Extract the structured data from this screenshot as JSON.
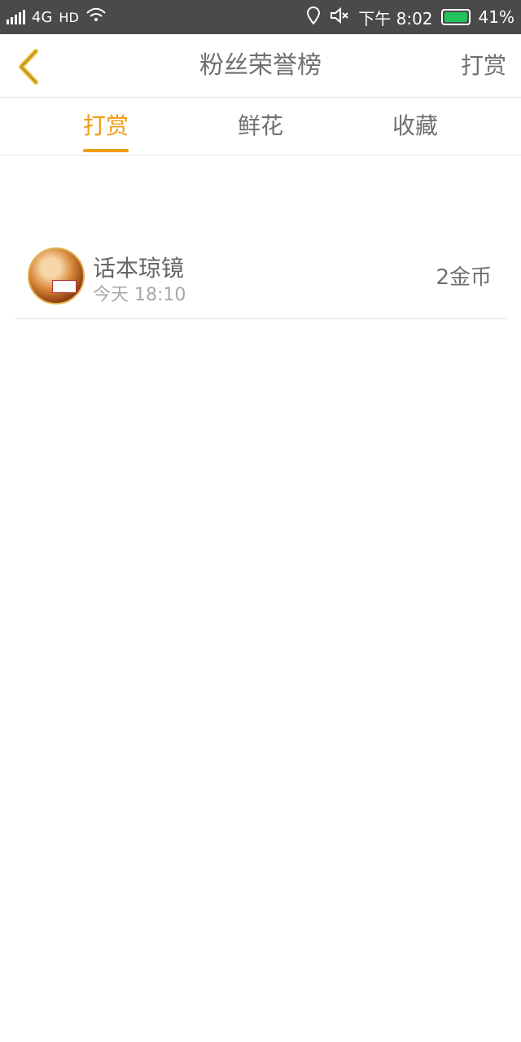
{
  "status_bar": {
    "network": "4G",
    "hd": "HD",
    "time": "下午 8:02",
    "battery": "41%",
    "battery_color": "#22c35e"
  },
  "header": {
    "title": "粉丝荣誉榜",
    "action": "打赏",
    "back_icon": "chevron-left-icon",
    "back_color": "#f2c230"
  },
  "tabs": [
    {
      "label": "打赏",
      "active": true
    },
    {
      "label": "鲜花",
      "active": false
    },
    {
      "label": "收藏",
      "active": false
    }
  ],
  "accent_color": "#f09b15",
  "list": [
    {
      "name": "话本琼镜",
      "time": "今天 18:10",
      "amount": "2金币"
    }
  ]
}
